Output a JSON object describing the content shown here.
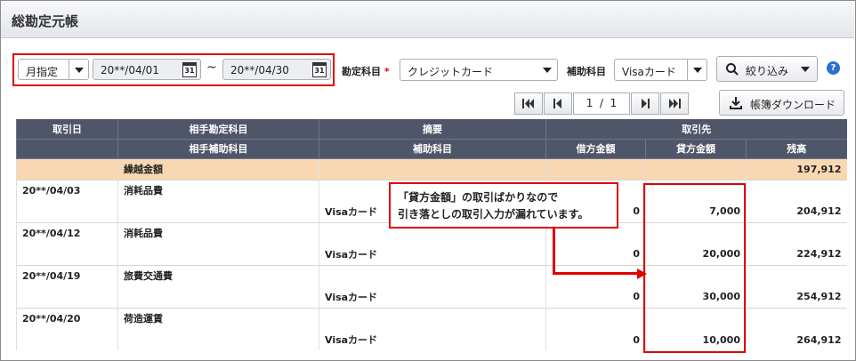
{
  "window": {
    "title": "総勘定元帳"
  },
  "filter": {
    "period_type": "月指定",
    "date_from": "20**/04/01",
    "date_to": "20**/04/30",
    "tilde": "~",
    "calendar_day": "31",
    "account_label": "勘定科目",
    "required_mark": "*",
    "account_value": "クレジットカード",
    "sub_account_label": "補助科目",
    "sub_account_value": "Visaカード",
    "narrow_label": "絞り込み",
    "help": "?"
  },
  "pager": {
    "current": "1",
    "sep": "/",
    "total": "1"
  },
  "download_label": "帳簿ダウンロード",
  "table": {
    "headers_row1": [
      "取引日",
      "相手勘定科目",
      "摘要",
      "取引先"
    ],
    "headers_row2": [
      "",
      "相手補助科目",
      "補助科目",
      "借方金額",
      "貸方金額",
      "残高"
    ],
    "carry": {
      "label": "繰越金額",
      "balance": "197,912"
    },
    "rows": [
      {
        "date": "20**/04/03",
        "account": "消耗品費",
        "sub": "Visaカード",
        "debit": "0",
        "credit": "7,000",
        "balance": "204,912"
      },
      {
        "date": "20**/04/12",
        "account": "消耗品費",
        "sub": "Visaカード",
        "debit": "0",
        "credit": "20,000",
        "balance": "224,912"
      },
      {
        "date": "20**/04/19",
        "account": "旅費交通費",
        "sub": "Visaカード",
        "debit": "0",
        "credit": "30,000",
        "balance": "254,912"
      },
      {
        "date": "20**/04/20",
        "account": "荷造運賃",
        "sub": "Visaカード",
        "debit": "0",
        "credit": "10,000",
        "balance": "264,912"
      }
    ]
  },
  "annotation": {
    "line1": "「貸方金額」の取引ばかりなので",
    "line2": "引き落としの取引入力が漏れています。"
  },
  "colors": {
    "header": "#50566a",
    "carry": "#f8d8b2",
    "highlight": "#e00000",
    "help": "#2b6fd1"
  }
}
